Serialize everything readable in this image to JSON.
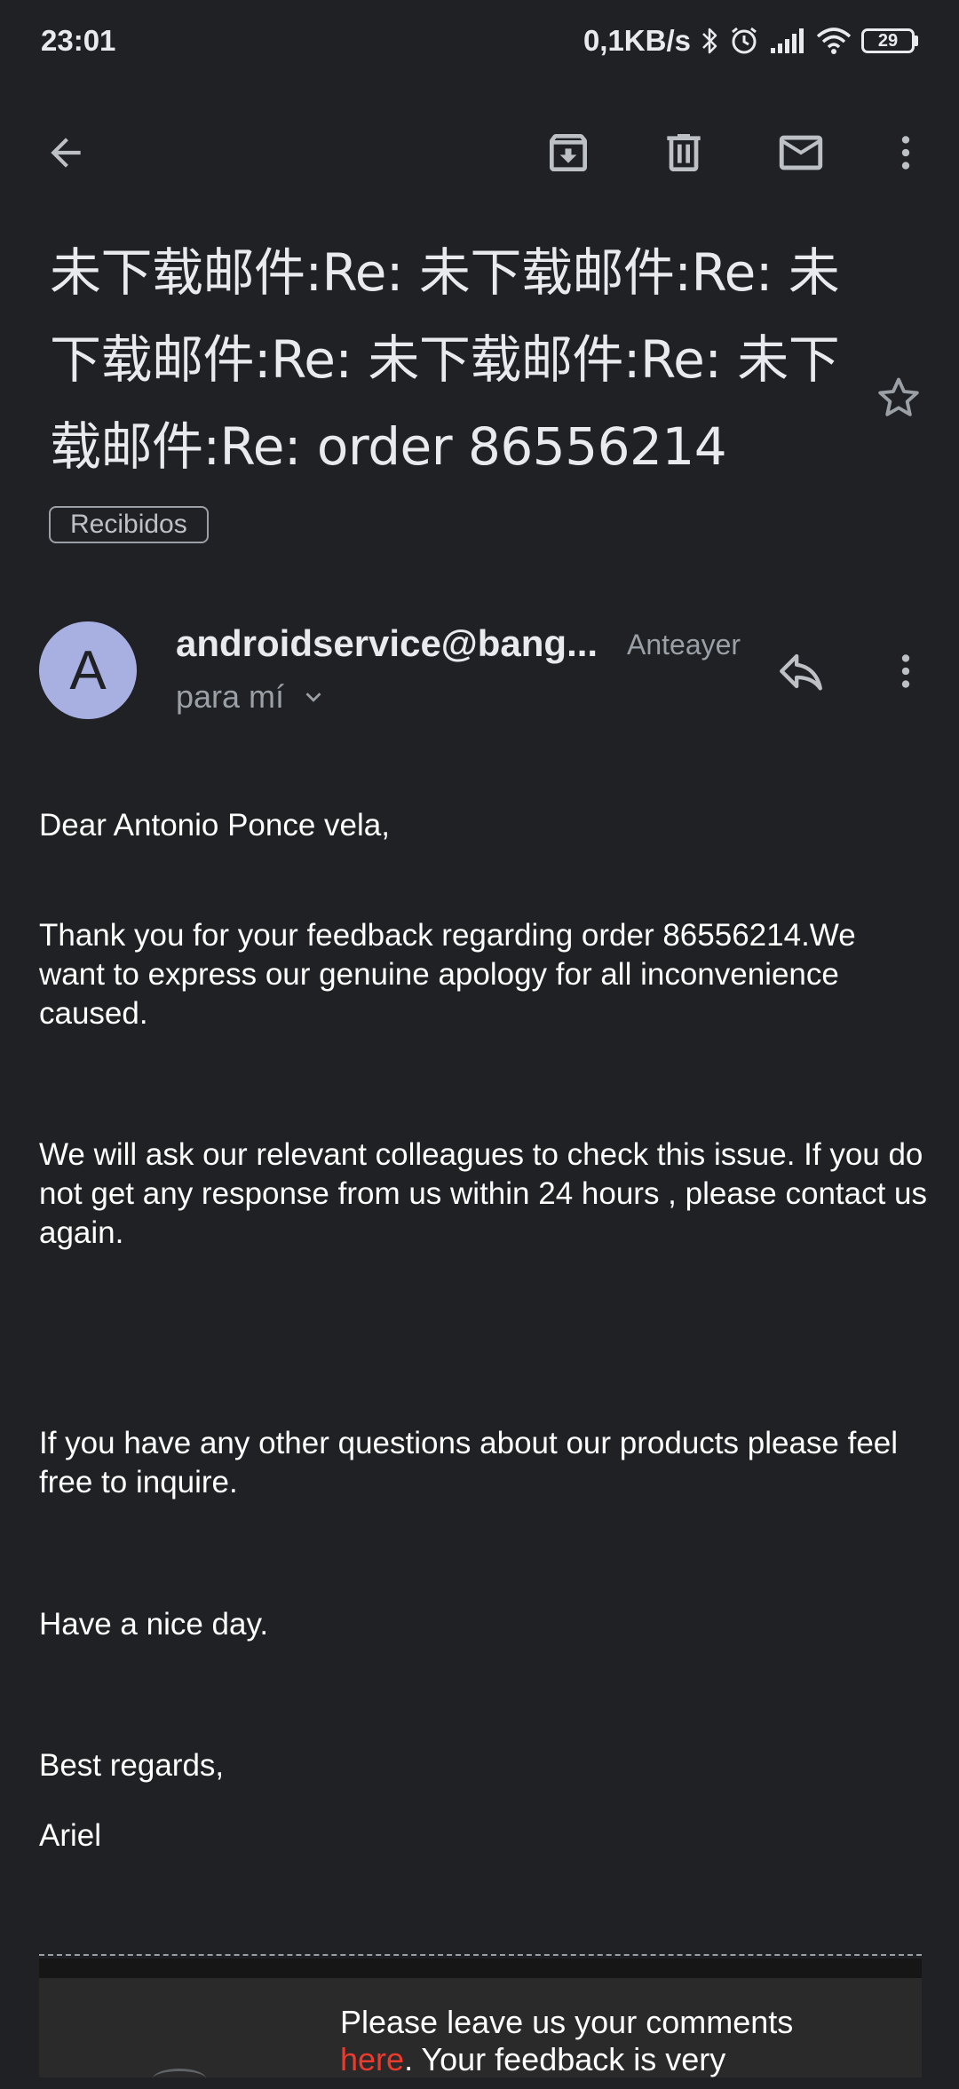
{
  "status_bar": {
    "time": "23:01",
    "net_speed": "0,1KB/s",
    "battery": "29"
  },
  "toolbar": {
    "icons": [
      "back-arrow-icon",
      "archive-icon",
      "delete-icon",
      "mail-icon",
      "more-vert-icon"
    ]
  },
  "email": {
    "subject": "未下载邮件:Re: 未下载邮件:Re: 未下载邮件:Re: 未下载邮件:Re: 未下载邮件:Re: order 86556214",
    "label": "Recibidos",
    "sender": {
      "avatar_letter": "A",
      "avatar_color": "#a8b0e2",
      "name": "androidservice@bang...",
      "date": "Anteayer",
      "recipient": "para mí"
    },
    "body": {
      "greeting": "Dear Antonio Ponce vela,",
      "p1": "Thank you for your feedback regarding order 86556214.We want to express our genuine apology for all inconvenience caused.",
      "p2": "We will ask our relevant colleagues to check this issue. If you do not get any response from us within 24 hours , please contact us again.",
      "p3": "If you have any other questions about our products please feel free to inquire.",
      "p4": "Have a nice day.",
      "closing": "Best regards,",
      "signature": "Ariel"
    },
    "footer": {
      "text_before": "Please leave us your comments",
      "link_text": "here",
      "text_after": ". Your feedback is very",
      "link_color": "#ea3b2e"
    }
  }
}
